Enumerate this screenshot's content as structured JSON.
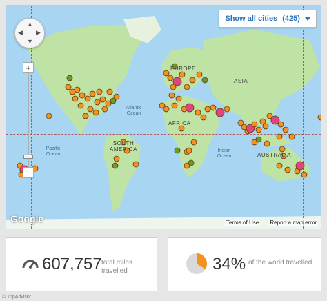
{
  "map": {
    "show_cities_label": "Show all cities",
    "cities_count": "(425)",
    "zoom_in": "+",
    "zoom_out": "−",
    "labels": {
      "europe": "EUROPE",
      "asia": "ASIA",
      "africa": "AFRICA",
      "south_america": "SOUTH AMERICA",
      "australia": "AUSTRALIA",
      "atlantic_ocean": "Atlantic Ocean",
      "pacific_ocean": "Pacific Ocean",
      "indian_ocean": "Indian Ocean"
    },
    "google_logo": "Google",
    "terms_link": "Terms of Use",
    "report_link": "Report a map error",
    "colors": {
      "water": "#a8d6f2",
      "land": "#bfe3a4",
      "orange": "#f39221",
      "green": "#6a9a2a",
      "pink": "#e0457b"
    }
  },
  "stats": {
    "miles_value": "607,757",
    "miles_label": "total miles travelled",
    "world_value": "34%",
    "world_label": "of the world travelled",
    "world_fraction": 0.34
  },
  "credit": "© TripAdvisor"
}
